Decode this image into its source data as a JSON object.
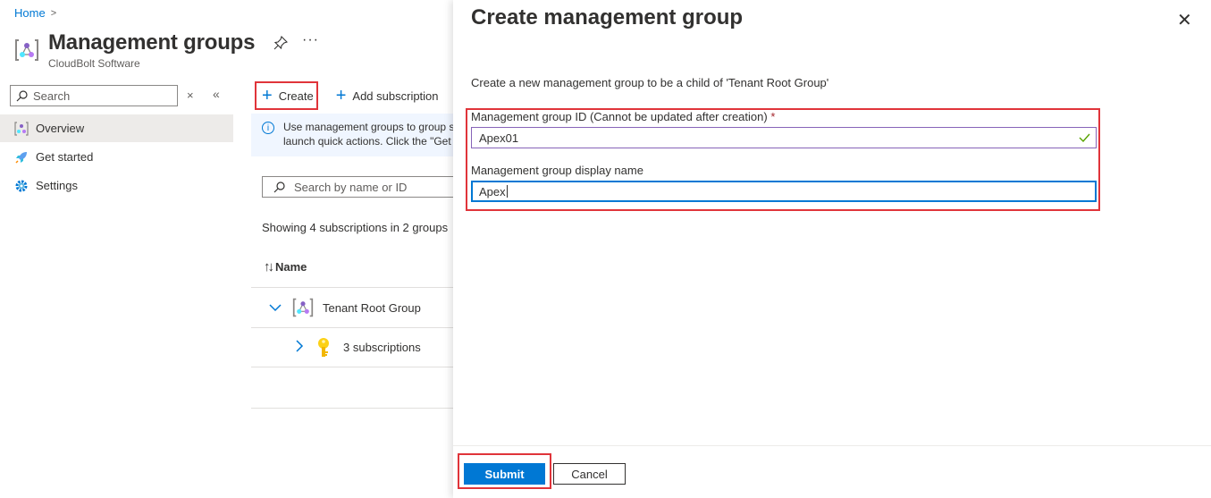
{
  "breadcrumb": {
    "home": "Home",
    "separator": ">"
  },
  "header": {
    "title": "Management groups",
    "subtitle": "CloudBolt Software",
    "more": "···"
  },
  "nav": {
    "search_placeholder": "Search",
    "items": [
      {
        "label": "Overview",
        "icon": "management-group-icon",
        "active": true
      },
      {
        "label": "Get started",
        "icon": "rocket-icon",
        "active": false
      },
      {
        "label": "Settings",
        "icon": "gear-icon",
        "active": false
      }
    ]
  },
  "toolbar": {
    "create_label": "Create",
    "add_subscription_label": "Add subscription"
  },
  "info": {
    "line1": "Use management groups to group s",
    "line2": "launch quick actions. Click the \"Get"
  },
  "list": {
    "search_placeholder": "Search by name or ID",
    "showing": "Showing 4 subscriptions in 2 groups",
    "column_name": "Name",
    "rows": [
      {
        "label": "Tenant Root Group",
        "icon": "management-group-icon"
      },
      {
        "label": "3 subscriptions",
        "icon": "key-icon"
      }
    ]
  },
  "panel": {
    "title": "Create management group",
    "close": "✕",
    "description": "Create a new management group to be a child of 'Tenant Root Group'",
    "id_label": "Management group ID (Cannot be updated after creation)",
    "required_mark": "*",
    "id_value": "Apex01",
    "display_name_label": "Management group display name",
    "display_name_value": "Apex",
    "submit_label": "Submit",
    "cancel_label": "Cancel"
  },
  "colors": {
    "accent": "#0078d4",
    "highlight": "#e0343a",
    "valid": "#57a300"
  }
}
